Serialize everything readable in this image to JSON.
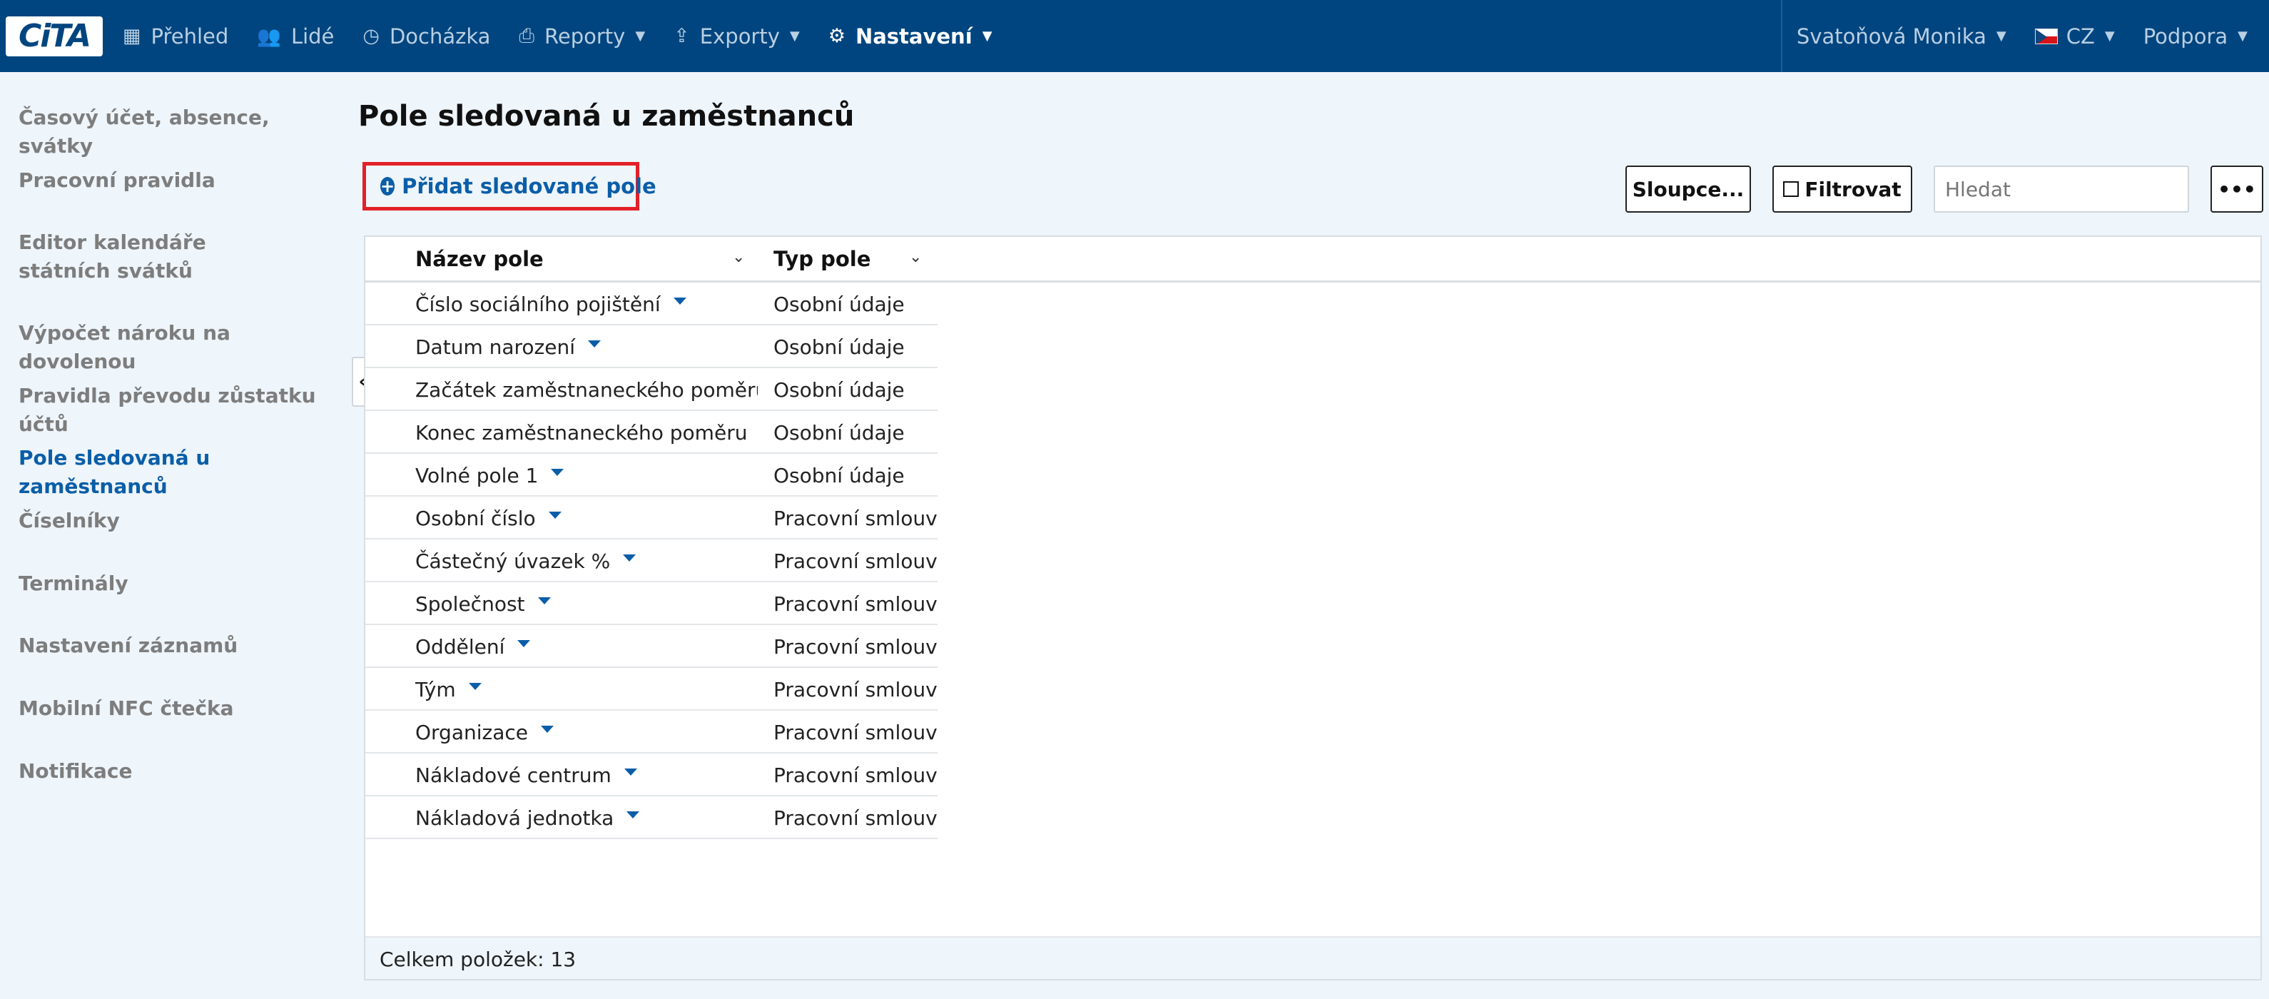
{
  "navbar": {
    "logo": "CiTA",
    "items": [
      {
        "label": "Přehled",
        "icon": "grid-icon"
      },
      {
        "label": "Lidé",
        "icon": "users-icon"
      },
      {
        "label": "Docházka",
        "icon": "clock-icon"
      },
      {
        "label": "Reporty",
        "icon": "print-icon"
      },
      {
        "label": "Exporty",
        "icon": "export-icon"
      },
      {
        "label": "Nastavení",
        "icon": "gear-icon"
      }
    ],
    "user": "Svatoňová Monika",
    "language": "CZ",
    "support": "Podpora"
  },
  "sidebar": {
    "items": [
      {
        "label": "Časový účet, absence, svátky"
      },
      {
        "label": "Pracovní pravidla"
      },
      {
        "label": "Editor kalendáře státních svátků"
      },
      {
        "label": "Výpočet nároku na dovolenou"
      },
      {
        "label": "Pravidla převodu zůstatku účtů"
      },
      {
        "label": "Pole sledovaná u zaměstnanců"
      },
      {
        "label": "Číselníky"
      },
      {
        "label": "Terminály"
      },
      {
        "label": "Nastavení záznamů"
      },
      {
        "label": "Mobilní NFC čtečka"
      },
      {
        "label": "Notifikace"
      }
    ],
    "active_index": 5
  },
  "main": {
    "title": "Pole sledovaná u zaměstnanců",
    "add_button": "Přidat sledované pole",
    "columns_button": "Sloupce...",
    "filter_button": "Filtrovat",
    "search_placeholder": "Hledat",
    "more_button": "•••",
    "grid": {
      "headers": [
        "Název pole",
        "Typ pole"
      ],
      "rows": [
        {
          "name": "Číslo sociálního pojištění",
          "type": "Osobní údaje"
        },
        {
          "name": "Datum narození",
          "type": "Osobní údaje"
        },
        {
          "name": "Začátek zaměstnaneckého poměru",
          "type": "Osobní údaje"
        },
        {
          "name": "Konec zaměstnaneckého poměru",
          "type": "Osobní údaje"
        },
        {
          "name": "Volné pole 1",
          "type": "Osobní údaje"
        },
        {
          "name": "Osobní číslo",
          "type": "Pracovní smlouvy"
        },
        {
          "name": "Částečný úvazek %",
          "type": "Pracovní smlouvy"
        },
        {
          "name": "Společnost",
          "type": "Pracovní smlouvy"
        },
        {
          "name": "Oddělení",
          "type": "Pracovní smlouvy"
        },
        {
          "name": "Tým",
          "type": "Pracovní smlouvy"
        },
        {
          "name": "Organizace",
          "type": "Pracovní smlouvy"
        },
        {
          "name": "Nákladové centrum",
          "type": "Pracovní smlouvy"
        },
        {
          "name": "Nákladová jednotka",
          "type": "Pracovní smlouvy"
        }
      ],
      "footer": "Celkem položek: 13"
    }
  }
}
